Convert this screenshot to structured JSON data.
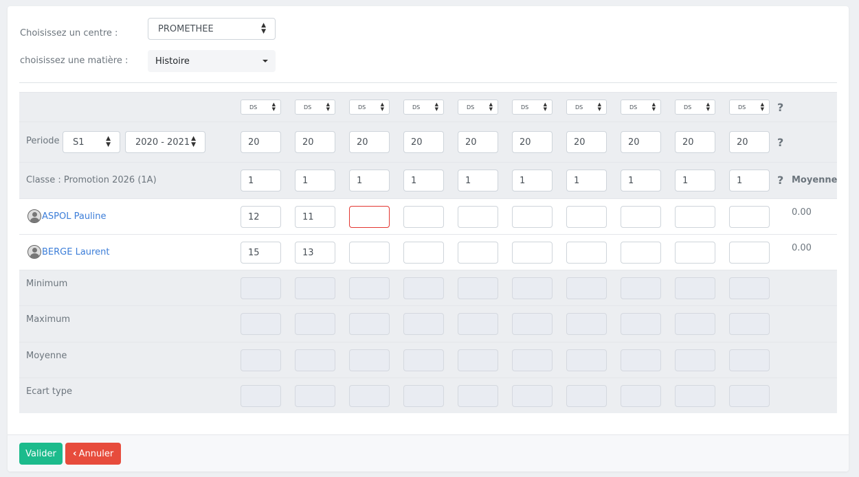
{
  "filters": {
    "centre_label": "Choisissez un centre :",
    "centre_value": "PROMETHEE",
    "matiere_label": "choisissez une matière :",
    "matiere_value": "Histoire"
  },
  "header": {
    "type_options": [
      "DS",
      "DS",
      "DS",
      "DS",
      "DS",
      "DS",
      "DS",
      "DS",
      "DS",
      "DS"
    ],
    "periode_label": "Periode",
    "periode_value": "S1",
    "annee_value": "2020 - 2021",
    "max_notes": [
      "20",
      "20",
      "20",
      "20",
      "20",
      "20",
      "20",
      "20",
      "20",
      "20"
    ],
    "classe_label": "Classe : Promotion 2026 (1A)",
    "coefficients": [
      "1",
      "1",
      "1",
      "1",
      "1",
      "1",
      "1",
      "1",
      "1",
      "1"
    ],
    "help_symbol": "?",
    "moyenne_header": "Moyenne"
  },
  "students": [
    {
      "name": "ASPOL Pauline",
      "grades": [
        "12",
        "11",
        "",
        "",
        "",
        "",
        "",
        "",
        "",
        ""
      ],
      "average": "0.00"
    },
    {
      "name": "BERGE Laurent",
      "grades": [
        "15",
        "13",
        "",
        "",
        "",
        "",
        "",
        "",
        "",
        ""
      ],
      "average": "0.00"
    }
  ],
  "stats": {
    "minimum_label": "Minimum",
    "maximum_label": "Maximum",
    "moyenne_label": "Moyenne",
    "ecart_label": "Ecart type"
  },
  "footer": {
    "valider_label": "Valider",
    "annuler_label": "Annuler"
  },
  "icons": {
    "sort_arrows": "sort-arrows-icon",
    "caret": "caret-down-icon",
    "help": "question-icon",
    "avatar": "user-avatar-icon",
    "chevron": "chevron-left-icon"
  },
  "colors": {
    "link": "#3b7dd8",
    "success": "#1cbb8c",
    "danger": "#e74c3c",
    "error_border": "#e3342f",
    "row_gray": "#eceef1"
  }
}
